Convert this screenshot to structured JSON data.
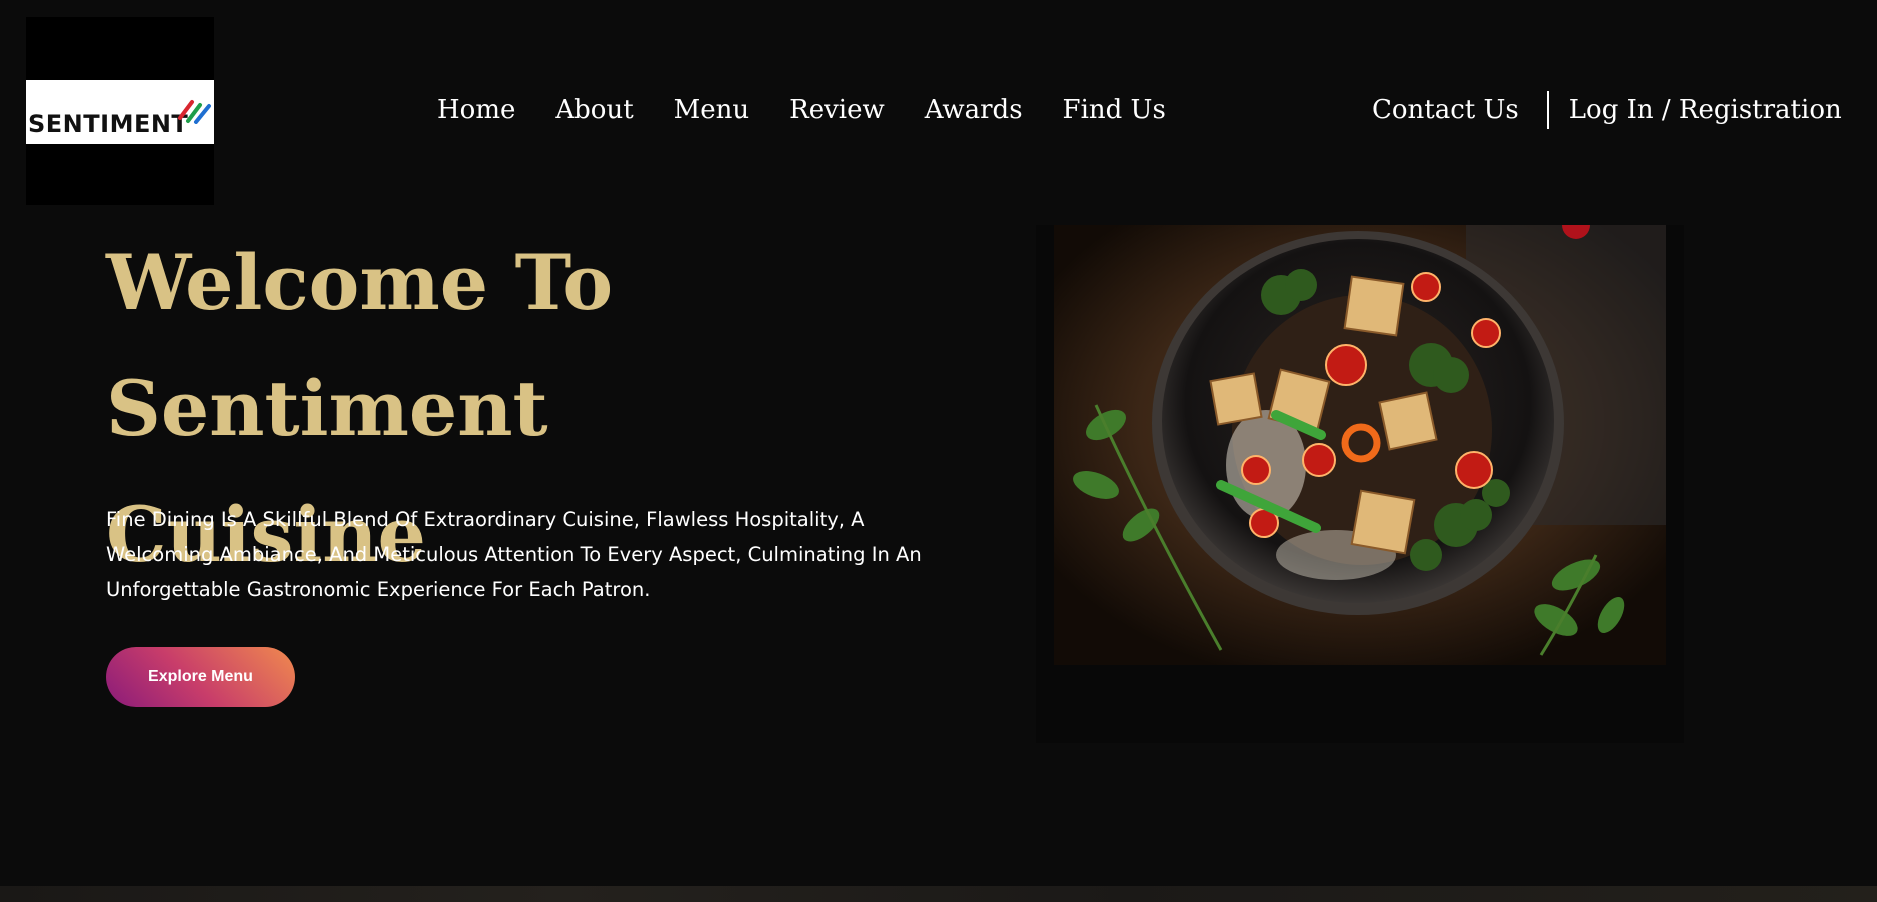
{
  "logo": {
    "text": "SENTIMENT",
    "icon": "sentiment-logo-mark"
  },
  "nav": {
    "items": [
      "Home",
      "About",
      "Menu",
      "Review",
      "Awards",
      "Find Us"
    ],
    "contact": "Contact Us",
    "login": "Log In / Registration"
  },
  "hero": {
    "title_line1": "Welcome To Sentiment",
    "title_line2": "Cuisine",
    "description": "Fine Dining Is A Skillful Blend Of Extraordinary Cuisine, Flawless Hospitality, A Welcoming Ambiance, And Meticulous Attention To Every Aspect, Culminating In An Unforgettable Gastronomic Experience For Each Patron.",
    "button": "Explore Menu"
  },
  "colors": {
    "background": "#0b0b0b",
    "title_gold": "#d9c285",
    "button_gradient": [
      "#8a1b7a",
      "#c83d6a",
      "#f08a4e"
    ]
  }
}
